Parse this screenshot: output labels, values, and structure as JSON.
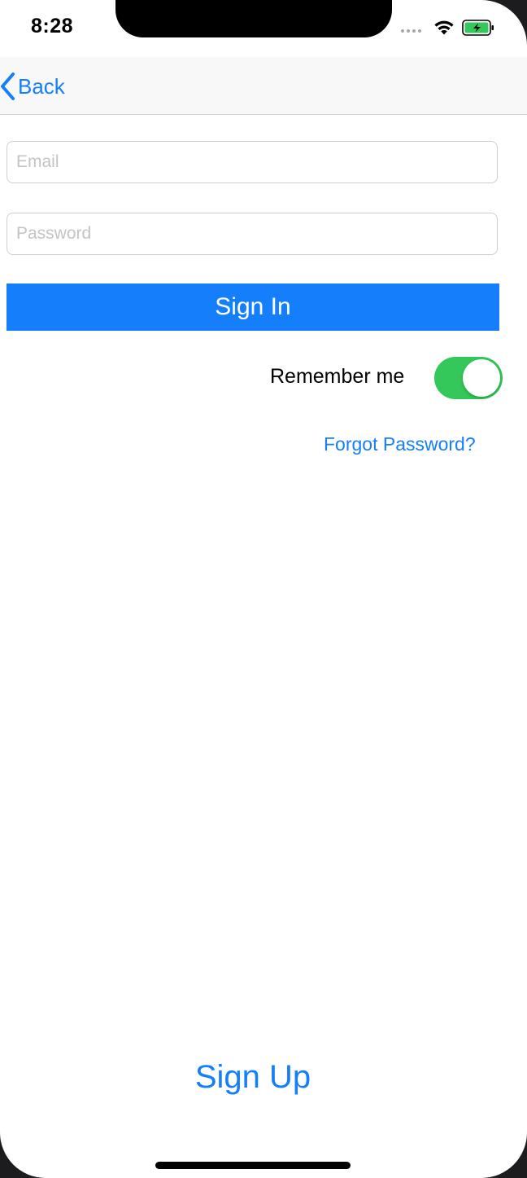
{
  "status_bar": {
    "time": "8:28",
    "icons": [
      "signal-dots-icon",
      "wifi-icon",
      "battery-charging-icon"
    ]
  },
  "nav": {
    "back_label": "Back"
  },
  "form": {
    "email_placeholder": "Email",
    "email_value": "",
    "password_placeholder": "Password",
    "password_value": "",
    "signin_label": "Sign In",
    "remember_label": "Remember me",
    "remember_on": true,
    "forgot_label": "Forgot Password?"
  },
  "footer": {
    "signup_label": "Sign Up"
  },
  "colors": {
    "accent": "#147efb",
    "toggle_on": "#34c759",
    "battery": "#34c759"
  }
}
